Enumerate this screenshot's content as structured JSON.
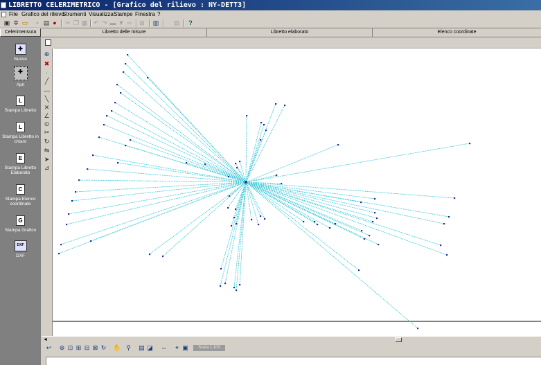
{
  "window": {
    "title": "LIBRETTO CELERIMETRICO - [Grafico del rilievo : NY-DETT3]"
  },
  "menu": [
    "File",
    "Grafico del rilievo",
    "Strumenti",
    "Visualizza",
    "Stampe",
    "Finestra",
    "?"
  ],
  "toolbar": {
    "icons": [
      "new-doc-icon",
      "settings-icon",
      "open-folder-icon",
      "save-icon",
      "print-icon",
      "record-icon",
      "cut-icon",
      "copy-icon",
      "paste-icon",
      "undo-icon",
      "redo-icon",
      "filter-icon",
      "binoculars-icon",
      "tree-icon",
      "list-icon",
      "help-icon"
    ]
  },
  "sidebar": {
    "header": "Celerimensura",
    "items": [
      {
        "label": "Nuovo",
        "icon": "new-survey-icon"
      },
      {
        "label": "Apri",
        "icon": "open-survey-icon",
        "selected": true
      },
      {
        "label": "Stampa Libretto",
        "icon": "print-book-icon",
        "glyph": "L"
      },
      {
        "label": "Stampa Libretto in chiaro",
        "icon": "print-book-clear-icon",
        "glyph": "L"
      },
      {
        "label": "Stampa Libretto Elaborato",
        "icon": "print-elaborated-icon",
        "glyph": "E"
      },
      {
        "label": "Stampa Elenco coordinate",
        "icon": "print-coordinates-icon",
        "glyph": "C"
      },
      {
        "label": "Stampa Grafico",
        "icon": "print-graph-icon",
        "glyph": "G"
      },
      {
        "label": "DXF",
        "icon": "dxf-icon",
        "glyph": "DXF"
      }
    ]
  },
  "tabs": [
    "Libretto delle misure",
    "Libretto elaborato",
    "Elenco coordinate"
  ],
  "bottom_toolbar": {
    "scale": "Scala 1:100"
  },
  "plot": {
    "line_color": "#3cc8d8",
    "point_color": "#1a2e9e"
  }
}
